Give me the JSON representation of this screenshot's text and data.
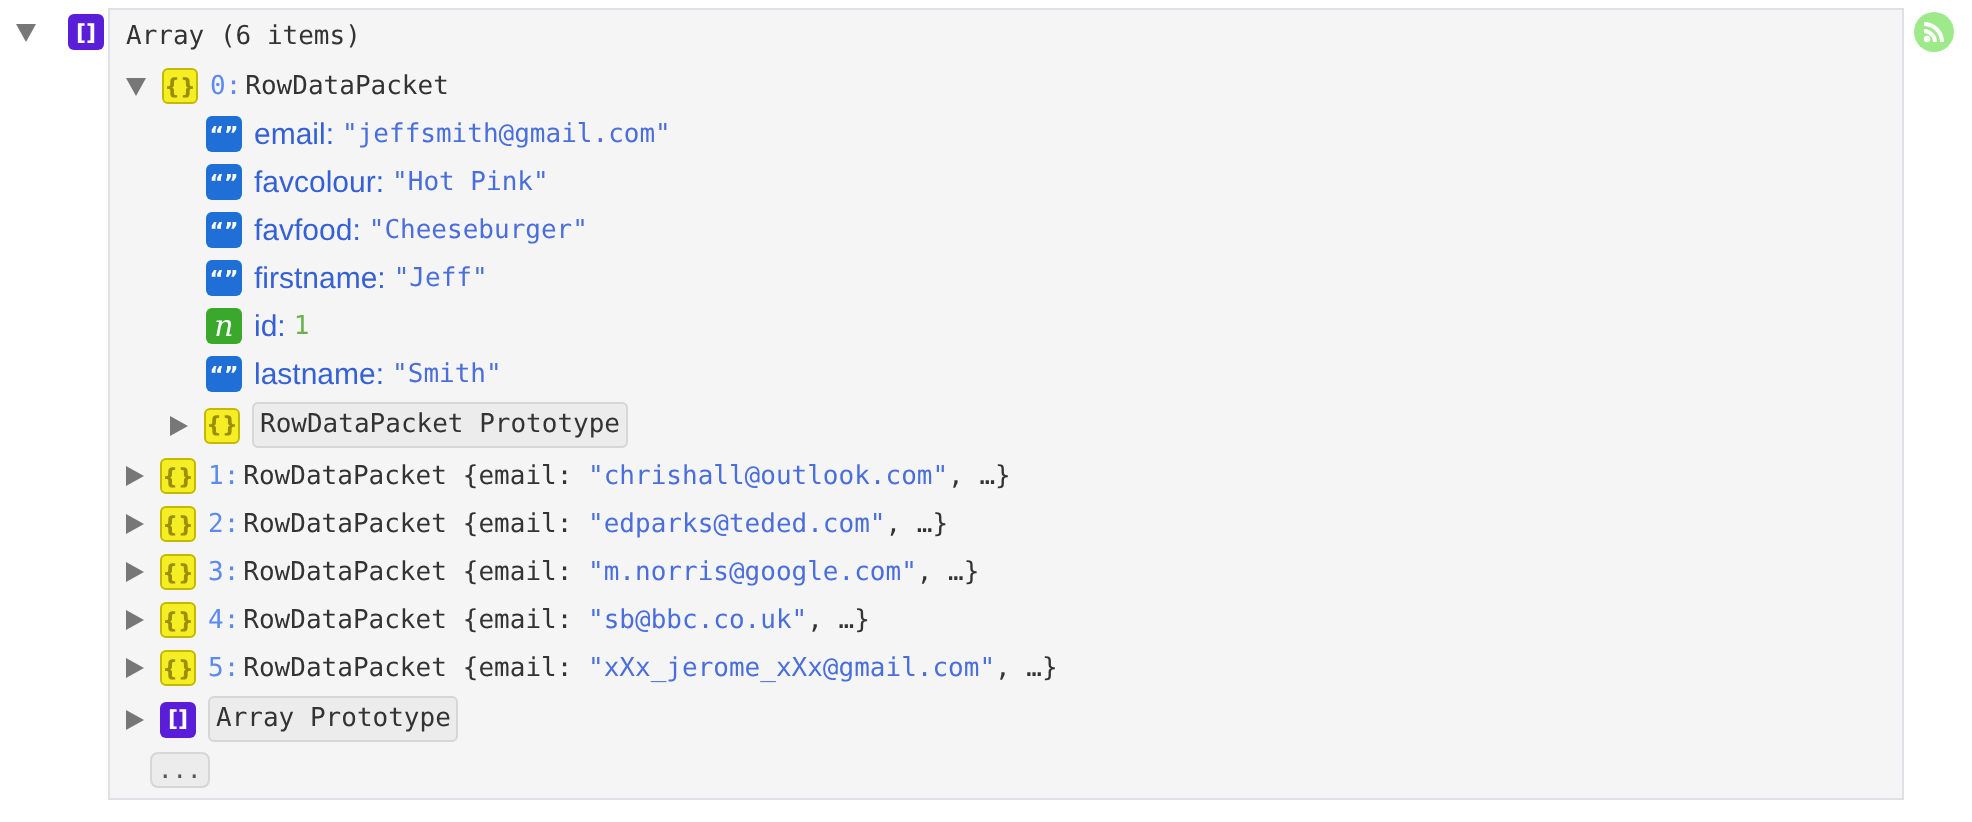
{
  "root": {
    "expanded": true,
    "kind": "array",
    "badge": "[]",
    "summary": "Array (6 items)",
    "items": [
      {
        "index": "0:",
        "class_name": "RowDataPacket",
        "kind": "object",
        "badge": "{}",
        "expanded": true,
        "properties": [
          {
            "kind": "string",
            "badge": "“”",
            "key": "email:",
            "value": "\"jeffsmith@gmail.com\""
          },
          {
            "kind": "string",
            "badge": "“”",
            "key": "favcolour:",
            "value": "\"Hot Pink\""
          },
          {
            "kind": "string",
            "badge": "“”",
            "key": "favfood:",
            "value": "\"Cheeseburger\""
          },
          {
            "kind": "string",
            "badge": "“”",
            "key": "firstname:",
            "value": "\"Jeff\""
          },
          {
            "kind": "number",
            "badge": "n",
            "key": "id:",
            "value": "1"
          },
          {
            "kind": "string",
            "badge": "“”",
            "key": "lastname:",
            "value": "\"Smith\""
          }
        ],
        "prototype": {
          "kind": "object",
          "badge": "{}",
          "expanded": false,
          "label": "RowDataPacket Prototype"
        }
      },
      {
        "index": "1:",
        "class_name": "RowDataPacket",
        "kind": "object",
        "badge": "{}",
        "expanded": false,
        "preview_open": "{email: ",
        "preview_value": "\"chrishall@outlook.com\"",
        "preview_close": ", …}"
      },
      {
        "index": "2:",
        "class_name": "RowDataPacket",
        "kind": "object",
        "badge": "{}",
        "expanded": false,
        "preview_open": "{email: ",
        "preview_value": "\"edparks@teded.com\"",
        "preview_close": ", …}"
      },
      {
        "index": "3:",
        "class_name": "RowDataPacket",
        "kind": "object",
        "badge": "{}",
        "expanded": false,
        "preview_open": "{email: ",
        "preview_value": "\"m.norris@google.com\"",
        "preview_close": ", …}"
      },
      {
        "index": "4:",
        "class_name": "RowDataPacket",
        "kind": "object",
        "badge": "{}",
        "expanded": false,
        "preview_open": "{email: ",
        "preview_value": "\"sb@bbc.co.uk\"",
        "preview_close": ", …}"
      },
      {
        "index": "5:",
        "class_name": "RowDataPacket",
        "kind": "object",
        "badge": "{}",
        "expanded": false,
        "preview_open": "{email: ",
        "preview_value": "\"xXx_jerome_xXx@gmail.com\"",
        "preview_close": ", …}"
      }
    ],
    "prototype": {
      "kind": "array",
      "badge": "[]",
      "expanded": false,
      "label": "Array Prototype"
    },
    "more": "..."
  }
}
